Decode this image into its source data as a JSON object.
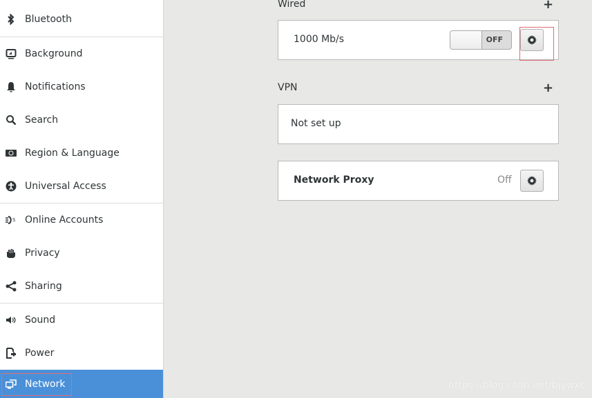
{
  "sidebar": {
    "items": [
      {
        "label": "Bluetooth",
        "icon": "bluetooth-icon"
      },
      {
        "label": "Background",
        "icon": "background-icon"
      },
      {
        "label": "Notifications",
        "icon": "bell-icon"
      },
      {
        "label": "Search",
        "icon": "search-icon"
      },
      {
        "label": "Region & Language",
        "icon": "region-icon"
      },
      {
        "label": "Universal Access",
        "icon": "accessibility-icon"
      },
      {
        "label": "Online Accounts",
        "icon": "online-accounts-icon"
      },
      {
        "label": "Privacy",
        "icon": "hand-icon"
      },
      {
        "label": "Sharing",
        "icon": "share-icon"
      },
      {
        "label": "Sound",
        "icon": "speaker-icon"
      },
      {
        "label": "Power",
        "icon": "power-icon"
      },
      {
        "label": "Network",
        "icon": "network-icon",
        "active": true
      }
    ]
  },
  "main": {
    "wired": {
      "title": "Wired",
      "add_label": "+",
      "speed": "1000 Mb/s",
      "switch_label": "OFF",
      "switch_state": "off"
    },
    "vpn": {
      "title": "VPN",
      "add_label": "+",
      "status": "Not set up"
    },
    "proxy": {
      "title": "Network Proxy",
      "status": "Off"
    }
  },
  "colors": {
    "accent": "#4a90d9",
    "highlight_box": "#e06c75"
  },
  "watermark": "https://blog.csdn.net/bjywxc"
}
